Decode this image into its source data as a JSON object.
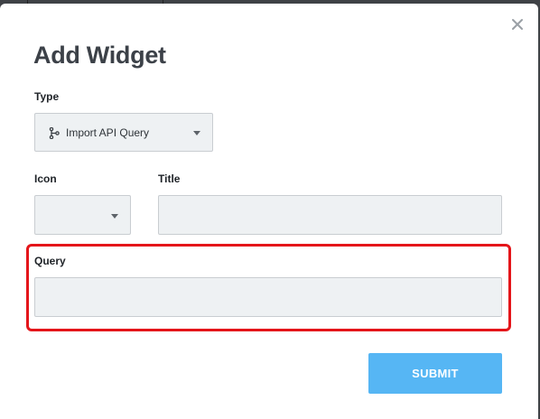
{
  "dialog": {
    "title": "Add Widget",
    "close_icon": "close-icon",
    "fields": {
      "type": {
        "label": "Type",
        "value": "Import API Query",
        "icon": "branch-icon"
      },
      "icon": {
        "label": "Icon",
        "value": ""
      },
      "title": {
        "label": "Title",
        "value": "",
        "placeholder": ""
      },
      "query": {
        "label": "Query",
        "value": "",
        "placeholder": ""
      }
    },
    "submit_label": "SUBMIT"
  },
  "colors": {
    "submit_button": "#56b6f4",
    "highlight_border": "#e4151a",
    "field_background": "#eef1f3",
    "title_text": "#3c4148"
  }
}
